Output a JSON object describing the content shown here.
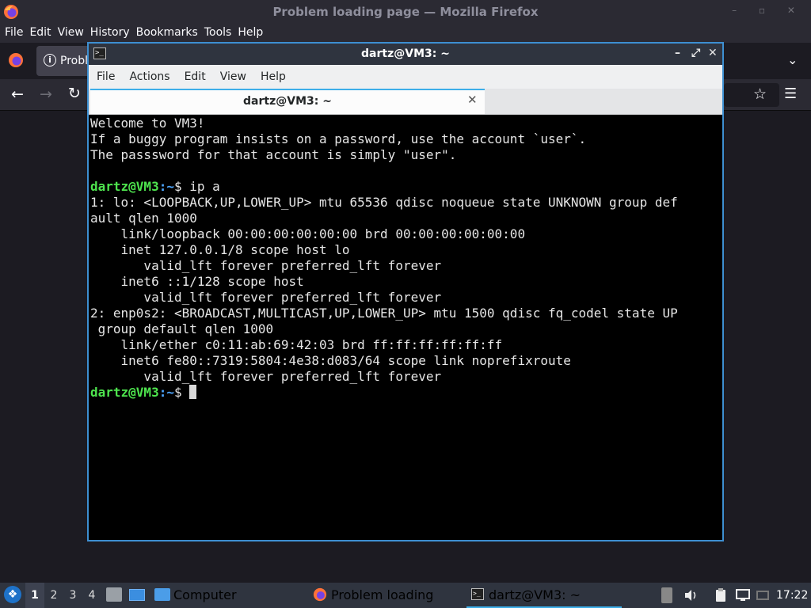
{
  "firefox": {
    "window_title": "Problem loading page — Mozilla Firefox",
    "menu": [
      "File",
      "Edit",
      "View",
      "History",
      "Bookmarks",
      "Tools",
      "Help"
    ],
    "tab_title": "Probl",
    "window_controls": "– ▫ ✕"
  },
  "terminal": {
    "title": "dartz@VM3: ~",
    "menu": [
      "File",
      "Actions",
      "Edit",
      "View",
      "Help"
    ],
    "tab_title": "dartz@VM3: ~",
    "lines": [
      {
        "text": "Welcome to VM3!"
      },
      {
        "text": "If a buggy program insists on a password, use the account `user`."
      },
      {
        "text": "The passsword for that account is simply \"user\"."
      },
      {
        "text": ""
      },
      {
        "user": "dartz@VM3",
        "path": ":~",
        "text": "$ ip a"
      },
      {
        "text": "1: lo: <LOOPBACK,UP,LOWER_UP> mtu 65536 qdisc noqueue state UNKNOWN group def"
      },
      {
        "text": "ault qlen 1000"
      },
      {
        "text": "    link/loopback 00:00:00:00:00:00 brd 00:00:00:00:00:00"
      },
      {
        "text": "    inet 127.0.0.1/8 scope host lo"
      },
      {
        "text": "       valid_lft forever preferred_lft forever"
      },
      {
        "text": "    inet6 ::1/128 scope host"
      },
      {
        "text": "       valid_lft forever preferred_lft forever"
      },
      {
        "text": "2: enp0s2: <BROADCAST,MULTICAST,UP,LOWER_UP> mtu 1500 qdisc fq_codel state UP"
      },
      {
        "text": " group default qlen 1000"
      },
      {
        "text": "    link/ether c0:11:ab:69:42:03 brd ff:ff:ff:ff:ff:ff"
      },
      {
        "text": "    inet6 fe80::7319:5804:4e38:d083/64 scope link noprefixroute"
      },
      {
        "text": "       valid_lft forever preferred_lft forever"
      },
      {
        "user": "dartz@VM3",
        "path": ":~",
        "text": "$ ",
        "cursor": true
      }
    ]
  },
  "taskbar": {
    "workspaces": [
      "1",
      "2",
      "3",
      "4"
    ],
    "active_workspace": "1",
    "tasks": {
      "computer": "Computer",
      "firefox": "Problem loading pag...",
      "terminal": "dartz@VM3: ~"
    },
    "clock": "17:22"
  },
  "colors": {
    "accent": "#3daee9",
    "prompt_user": "#4ee44e",
    "prompt_path": "#4da6ff",
    "terminal_bg": "#000000"
  },
  "icons": [
    "firefox-icon",
    "info-icon",
    "back-icon",
    "forward-icon",
    "reload-icon",
    "star-icon",
    "menu-icon",
    "terminal-icon",
    "start-menu-icon",
    "files-icon",
    "desktop-icon",
    "computer-icon",
    "volume-icon",
    "clipboard-icon",
    "network-icon"
  ]
}
